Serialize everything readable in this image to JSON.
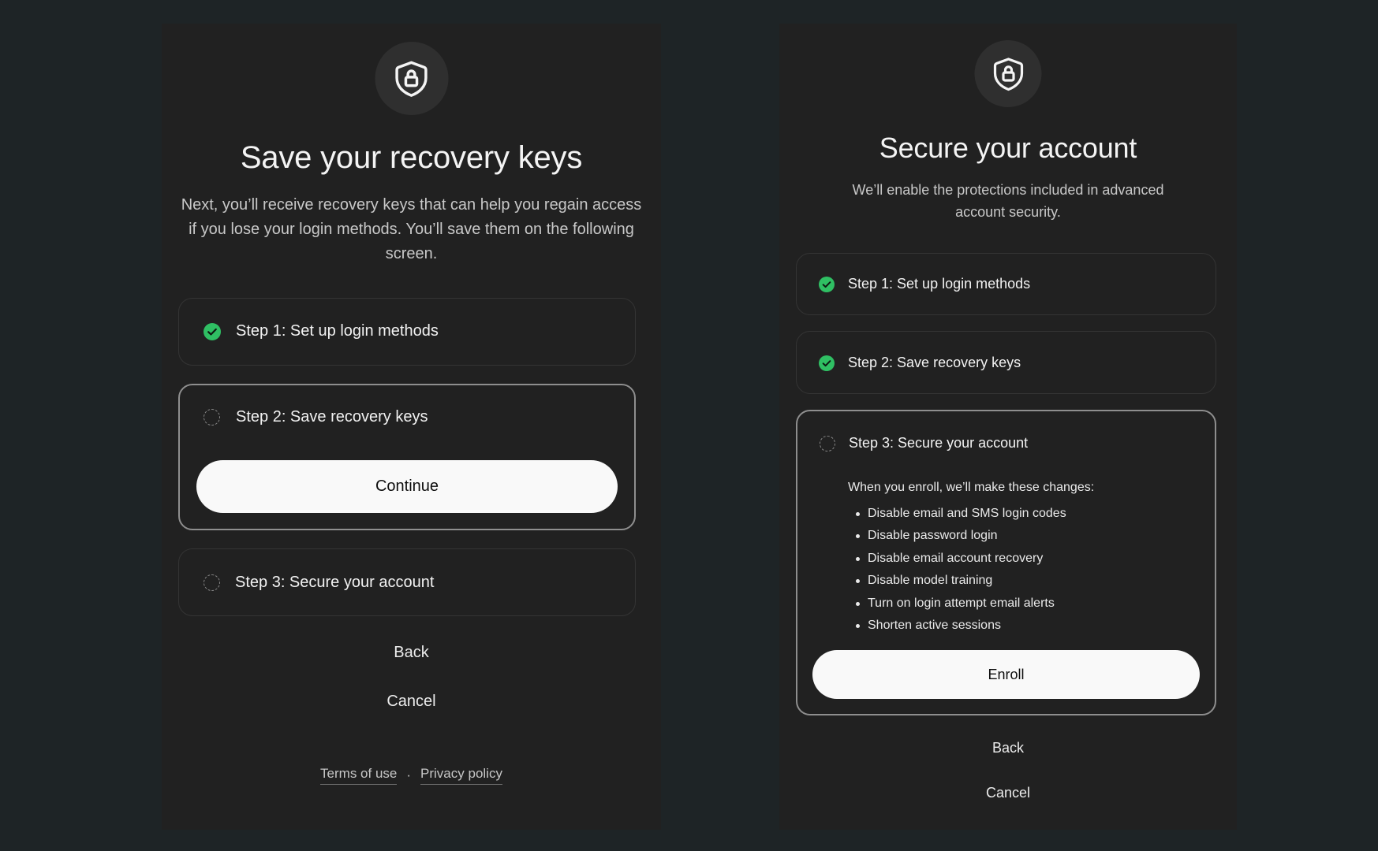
{
  "left": {
    "title": "Save your recovery keys",
    "description": "Next, you’ll receive recovery keys that can help you regain access if you lose your login methods. You’ll save them on the following screen.",
    "steps": [
      {
        "label": "Step 1: Set up login methods",
        "status": "complete"
      },
      {
        "label": "Step 2: Save recovery keys",
        "status": "active"
      },
      {
        "label": "Step 3: Secure your account",
        "status": "pending"
      }
    ],
    "continue_label": "Continue",
    "back_label": "Back",
    "cancel_label": "Cancel",
    "footer": {
      "terms": "Terms of use",
      "separator": "·",
      "privacy": "Privacy policy"
    }
  },
  "right": {
    "title": "Secure your account",
    "description": "We’ll enable the protections included in advanced account security.",
    "steps": [
      {
        "label": "Step 1: Set up login methods",
        "status": "complete"
      },
      {
        "label": "Step 2: Save recovery keys",
        "status": "complete"
      },
      {
        "label": "Step 3: Secure your account",
        "status": "active"
      }
    ],
    "changes_intro": "When you enroll, we’ll make these changes:",
    "changes": [
      "Disable email and SMS login codes",
      "Disable password login",
      "Disable email account recovery",
      "Disable model training",
      "Turn on login attempt email alerts",
      "Shorten active sessions"
    ],
    "enroll_label": "Enroll",
    "back_label": "Back",
    "cancel_label": "Cancel"
  },
  "colors": {
    "background": "#1e2426",
    "panel": "#212121",
    "check_green": "#2fbf63",
    "button_bg": "#f9f9f9",
    "button_text": "#0d0d0d"
  },
  "icons": {
    "header": "shield-lock-icon",
    "complete": "check-circle-icon",
    "pending": "dashed-circle-icon"
  }
}
